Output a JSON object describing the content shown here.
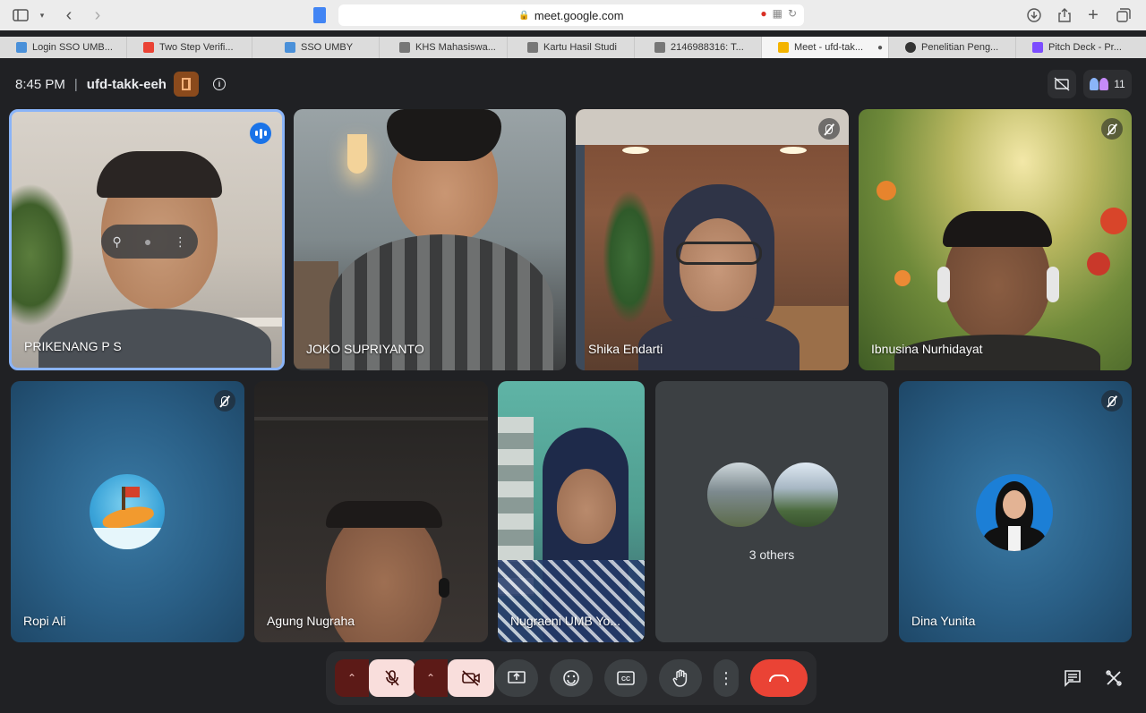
{
  "browser": {
    "url": "meet.google.com",
    "tabs": [
      {
        "label": "Login SSO UMB...",
        "color": "#4a90d9",
        "active": false
      },
      {
        "label": "Two Step Verifi...",
        "color": "#ea4335",
        "active": false
      },
      {
        "label": "SSO UMBY",
        "color": "#4a90d9",
        "active": false
      },
      {
        "label": "KHS Mahasiswa...",
        "color": "#777777",
        "active": false
      },
      {
        "label": "Kartu Hasil Studi",
        "color": "#777777",
        "active": false
      },
      {
        "label": "2146988316: T...",
        "color": "#777777",
        "active": false
      },
      {
        "label": "Meet - ufd-tak...",
        "color": "#f4b400",
        "active": true
      },
      {
        "label": "Penelitian Peng...",
        "color": "#333333",
        "active": false
      },
      {
        "label": "Pitch Deck - Pr...",
        "color": "#7c4dff",
        "active": false
      }
    ]
  },
  "meet": {
    "time": "8:45 PM",
    "separator": "|",
    "meeting_code": "ufd-takk-eeh",
    "participant_count": "11"
  },
  "participants": [
    {
      "name": "PRIKENANG P S",
      "muted": false,
      "speaking": true
    },
    {
      "name": "JOKO SUPRIYANTO",
      "muted": false,
      "speaking": false
    },
    {
      "name": "Shika Endarti",
      "muted": true,
      "speaking": false
    },
    {
      "name": "Ibnusina Nurhidayat",
      "muted": true,
      "speaking": false
    },
    {
      "name": "Ropi Ali",
      "muted": true,
      "speaking": false
    },
    {
      "name": "Agung Nugraha",
      "muted": false,
      "speaking": false
    },
    {
      "name": "Nugraeni UMB Yo...",
      "muted": false,
      "speaking": false
    },
    {
      "name": "Dina Yunita",
      "muted": true,
      "speaking": false
    }
  ],
  "others_label": "3 others",
  "colors": {
    "meet_bg": "#202124",
    "speaking_border": "#8ab4f8",
    "end_call": "#ea4335",
    "off_button_bg": "#f9dedc",
    "off_caret_bg": "#5c1a17"
  }
}
